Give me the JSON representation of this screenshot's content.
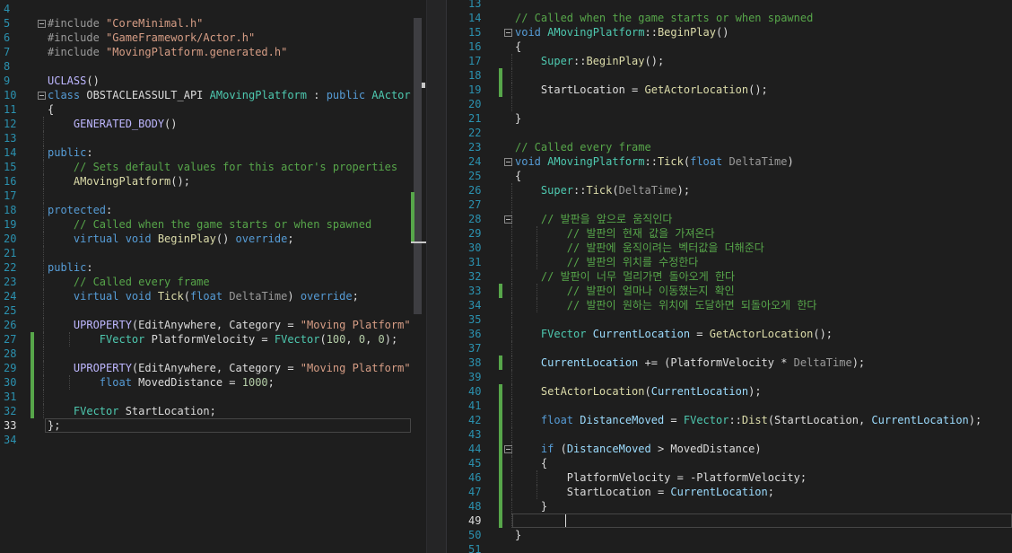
{
  "left_editor": {
    "file": "MovingPlatform.h",
    "lines": [
      {
        "n": "4",
        "tokens": []
      },
      {
        "n": "5",
        "tokens": [
          {
            "t": "#include ",
            "c": "pp"
          },
          {
            "t": "\"CoreMinimal.h\"",
            "c": "str"
          }
        ]
      },
      {
        "n": "6",
        "tokens": [
          {
            "t": "#include ",
            "c": "pp"
          },
          {
            "t": "\"GameFramework/Actor.h\"",
            "c": "str"
          }
        ]
      },
      {
        "n": "7",
        "tokens": [
          {
            "t": "#include ",
            "c": "pp"
          },
          {
            "t": "\"MovingPlatform.generated.h\"",
            "c": "str"
          }
        ]
      },
      {
        "n": "8",
        "tokens": []
      },
      {
        "n": "9",
        "tokens": [
          {
            "t": "UCLASS",
            "c": "mac"
          },
          {
            "t": "()",
            "c": "tx"
          }
        ]
      },
      {
        "n": "10",
        "tokens": [
          {
            "t": "class ",
            "c": "kw"
          },
          {
            "t": "OBSTACLEASSULT_API ",
            "c": "tx"
          },
          {
            "t": "AMovingPlatform",
            "c": "ty"
          },
          {
            "t": " : ",
            "c": "tx"
          },
          {
            "t": "public ",
            "c": "kw"
          },
          {
            "t": "AActor",
            "c": "ty"
          }
        ]
      },
      {
        "n": "11",
        "tokens": [
          {
            "t": "{",
            "c": "tx"
          }
        ]
      },
      {
        "n": "12",
        "tokens": [
          {
            "t": "    GENERATED_BODY",
            "c": "mac"
          },
          {
            "t": "()",
            "c": "tx"
          }
        ]
      },
      {
        "n": "13",
        "tokens": []
      },
      {
        "n": "14",
        "tokens": [
          {
            "t": "public",
            "c": "kw"
          },
          {
            "t": ":",
            "c": "tx"
          }
        ]
      },
      {
        "n": "15",
        "tokens": [
          {
            "t": "    // Sets default values for this actor's properties",
            "c": "cm"
          }
        ]
      },
      {
        "n": "16",
        "tokens": [
          {
            "t": "    ",
            "c": "tx"
          },
          {
            "t": "AMovingPlatform",
            "c": "fn"
          },
          {
            "t": "();",
            "c": "tx"
          }
        ]
      },
      {
        "n": "17",
        "tokens": []
      },
      {
        "n": "18",
        "tokens": [
          {
            "t": "protected",
            "c": "kw"
          },
          {
            "t": ":",
            "c": "tx"
          }
        ]
      },
      {
        "n": "19",
        "tokens": [
          {
            "t": "    // Called when the game starts or when spawned",
            "c": "cm"
          }
        ]
      },
      {
        "n": "20",
        "tokens": [
          {
            "t": "    virtual void ",
            "c": "kw"
          },
          {
            "t": "BeginPlay",
            "c": "fn"
          },
          {
            "t": "() ",
            "c": "tx"
          },
          {
            "t": "override",
            "c": "kw"
          },
          {
            "t": ";",
            "c": "tx"
          }
        ]
      },
      {
        "n": "21",
        "tokens": []
      },
      {
        "n": "22",
        "tokens": [
          {
            "t": "public",
            "c": "kw"
          },
          {
            "t": ":",
            "c": "tx"
          }
        ]
      },
      {
        "n": "23",
        "tokens": [
          {
            "t": "    // Called every frame",
            "c": "cm"
          }
        ]
      },
      {
        "n": "24",
        "tokens": [
          {
            "t": "    virtual void ",
            "c": "kw"
          },
          {
            "t": "Tick",
            "c": "fn"
          },
          {
            "t": "(",
            "c": "tx"
          },
          {
            "t": "float ",
            "c": "kw"
          },
          {
            "t": "DeltaTime",
            "c": "prm"
          },
          {
            "t": ") ",
            "c": "tx"
          },
          {
            "t": "override",
            "c": "kw"
          },
          {
            "t": ";",
            "c": "tx"
          }
        ]
      },
      {
        "n": "25",
        "tokens": []
      },
      {
        "n": "26",
        "tokens": [
          {
            "t": "    UPROPERTY",
            "c": "mac"
          },
          {
            "t": "(EditAnywhere, Category = ",
            "c": "tx"
          },
          {
            "t": "\"Moving Platform\"",
            "c": "str"
          },
          {
            "t": ")",
            "c": "tx"
          }
        ]
      },
      {
        "n": "27",
        "tokens": [
          {
            "t": "        ",
            "c": "tx"
          },
          {
            "t": "FVector ",
            "c": "ty"
          },
          {
            "t": "PlatformVelocity = ",
            "c": "tx"
          },
          {
            "t": "FVector",
            "c": "ty"
          },
          {
            "t": "(",
            "c": "tx"
          },
          {
            "t": "100",
            "c": "num"
          },
          {
            "t": ", ",
            "c": "tx"
          },
          {
            "t": "0",
            "c": "num"
          },
          {
            "t": ", ",
            "c": "tx"
          },
          {
            "t": "0",
            "c": "num"
          },
          {
            "t": ");",
            "c": "tx"
          }
        ]
      },
      {
        "n": "28",
        "tokens": []
      },
      {
        "n": "29",
        "tokens": [
          {
            "t": "    UPROPERTY",
            "c": "mac"
          },
          {
            "t": "(EditAnywhere, Category = ",
            "c": "tx"
          },
          {
            "t": "\"Moving Platform\"",
            "c": "str"
          },
          {
            "t": ")",
            "c": "tx"
          }
        ]
      },
      {
        "n": "30",
        "tokens": [
          {
            "t": "        ",
            "c": "tx"
          },
          {
            "t": "float ",
            "c": "kw"
          },
          {
            "t": "MovedDistance = ",
            "c": "tx"
          },
          {
            "t": "1000",
            "c": "num"
          },
          {
            "t": ";",
            "c": "tx"
          }
        ]
      },
      {
        "n": "31",
        "tokens": []
      },
      {
        "n": "32",
        "tokens": [
          {
            "t": "    ",
            "c": "tx"
          },
          {
            "t": "FVector ",
            "c": "ty"
          },
          {
            "t": "StartLocation;",
            "c": "tx"
          }
        ]
      },
      {
        "n": "33",
        "tokens": [
          {
            "t": "};",
            "c": "tx"
          }
        ]
      },
      {
        "n": "34",
        "tokens": []
      }
    ]
  },
  "right_editor": {
    "file": "MovingPlatform.cpp",
    "lines": [
      {
        "n": "13",
        "tokens": []
      },
      {
        "n": "14",
        "tokens": [
          {
            "t": "// Called when the game starts or when spawned",
            "c": "cm"
          }
        ]
      },
      {
        "n": "15",
        "tokens": [
          {
            "t": "void ",
            "c": "kw"
          },
          {
            "t": "AMovingPlatform",
            "c": "ty"
          },
          {
            "t": "::",
            "c": "tx"
          },
          {
            "t": "BeginPlay",
            "c": "fn"
          },
          {
            "t": "()",
            "c": "tx"
          }
        ]
      },
      {
        "n": "16",
        "tokens": [
          {
            "t": "{",
            "c": "tx"
          }
        ]
      },
      {
        "n": "17",
        "tokens": [
          {
            "t": "    ",
            "c": "tx"
          },
          {
            "t": "Super",
            "c": "ty"
          },
          {
            "t": "::",
            "c": "tx"
          },
          {
            "t": "BeginPlay",
            "c": "fn"
          },
          {
            "t": "();",
            "c": "tx"
          }
        ]
      },
      {
        "n": "18",
        "tokens": []
      },
      {
        "n": "19",
        "tokens": [
          {
            "t": "    StartLocation = ",
            "c": "tx"
          },
          {
            "t": "GetActorLocation",
            "c": "fn"
          },
          {
            "t": "();",
            "c": "tx"
          }
        ]
      },
      {
        "n": "20",
        "tokens": []
      },
      {
        "n": "21",
        "tokens": [
          {
            "t": "}",
            "c": "tx"
          }
        ]
      },
      {
        "n": "22",
        "tokens": []
      },
      {
        "n": "23",
        "tokens": [
          {
            "t": "// Called every frame",
            "c": "cm"
          }
        ]
      },
      {
        "n": "24",
        "tokens": [
          {
            "t": "void ",
            "c": "kw"
          },
          {
            "t": "AMovingPlatform",
            "c": "ty"
          },
          {
            "t": "::",
            "c": "tx"
          },
          {
            "t": "Tick",
            "c": "fn"
          },
          {
            "t": "(",
            "c": "tx"
          },
          {
            "t": "float ",
            "c": "kw"
          },
          {
            "t": "DeltaTime",
            "c": "prm"
          },
          {
            "t": ")",
            "c": "tx"
          }
        ]
      },
      {
        "n": "25",
        "tokens": [
          {
            "t": "{",
            "c": "tx"
          }
        ]
      },
      {
        "n": "26",
        "tokens": [
          {
            "t": "    ",
            "c": "tx"
          },
          {
            "t": "Super",
            "c": "ty"
          },
          {
            "t": "::",
            "c": "tx"
          },
          {
            "t": "Tick",
            "c": "fn"
          },
          {
            "t": "(",
            "c": "tx"
          },
          {
            "t": "DeltaTime",
            "c": "prm"
          },
          {
            "t": ");",
            "c": "tx"
          }
        ]
      },
      {
        "n": "27",
        "tokens": []
      },
      {
        "n": "28",
        "tokens": [
          {
            "t": "    // 발판을 앞으로 움직인다",
            "c": "cm"
          }
        ]
      },
      {
        "n": "29",
        "tokens": [
          {
            "t": "        // 발판의 현재 값을 가져온다",
            "c": "cm"
          }
        ]
      },
      {
        "n": "30",
        "tokens": [
          {
            "t": "        // 발판에 움직이려는 벡터값을 더해준다",
            "c": "cm"
          }
        ]
      },
      {
        "n": "31",
        "tokens": [
          {
            "t": "        // 발판의 위치를 수정한다",
            "c": "cm"
          }
        ]
      },
      {
        "n": "32",
        "tokens": [
          {
            "t": "    // 발판이 너무 멀리가면 돌아오게 한다",
            "c": "cm"
          }
        ]
      },
      {
        "n": "33",
        "tokens": [
          {
            "t": "        // 발판이 얼마나 이동했는지 확인",
            "c": "cm"
          }
        ]
      },
      {
        "n": "34",
        "tokens": [
          {
            "t": "        // 발판이 원하는 위치에 도달하면 되돌아오게 한다",
            "c": "cm"
          }
        ]
      },
      {
        "n": "35",
        "tokens": []
      },
      {
        "n": "36",
        "tokens": [
          {
            "t": "    ",
            "c": "tx"
          },
          {
            "t": "FVector ",
            "c": "ty"
          },
          {
            "t": "CurrentLocation",
            "c": "var"
          },
          {
            "t": " = ",
            "c": "tx"
          },
          {
            "t": "GetActorLocation",
            "c": "fn"
          },
          {
            "t": "();",
            "c": "tx"
          }
        ]
      },
      {
        "n": "37",
        "tokens": []
      },
      {
        "n": "38",
        "tokens": [
          {
            "t": "    ",
            "c": "tx"
          },
          {
            "t": "CurrentLocation",
            "c": "var"
          },
          {
            "t": " += (PlatformVelocity * ",
            "c": "tx"
          },
          {
            "t": "DeltaTime",
            "c": "prm"
          },
          {
            "t": ");",
            "c": "tx"
          }
        ]
      },
      {
        "n": "39",
        "tokens": []
      },
      {
        "n": "40",
        "tokens": [
          {
            "t": "    ",
            "c": "tx"
          },
          {
            "t": "SetActorLocation",
            "c": "fn"
          },
          {
            "t": "(",
            "c": "tx"
          },
          {
            "t": "CurrentLocation",
            "c": "var"
          },
          {
            "t": ");",
            "c": "tx"
          }
        ]
      },
      {
        "n": "41",
        "tokens": []
      },
      {
        "n": "42",
        "tokens": [
          {
            "t": "    ",
            "c": "tx"
          },
          {
            "t": "float ",
            "c": "kw"
          },
          {
            "t": "DistanceMoved",
            "c": "var"
          },
          {
            "t": " = ",
            "c": "tx"
          },
          {
            "t": "FVector",
            "c": "ty"
          },
          {
            "t": "::",
            "c": "tx"
          },
          {
            "t": "Dist",
            "c": "fn"
          },
          {
            "t": "(StartLocation, ",
            "c": "tx"
          },
          {
            "t": "CurrentLocation",
            "c": "var"
          },
          {
            "t": ");",
            "c": "tx"
          }
        ]
      },
      {
        "n": "43",
        "tokens": []
      },
      {
        "n": "44",
        "tokens": [
          {
            "t": "    ",
            "c": "tx"
          },
          {
            "t": "if ",
            "c": "kw"
          },
          {
            "t": "(",
            "c": "tx"
          },
          {
            "t": "DistanceMoved",
            "c": "var"
          },
          {
            "t": " > MovedDistance)",
            "c": "tx"
          }
        ]
      },
      {
        "n": "45",
        "tokens": [
          {
            "t": "    {",
            "c": "tx"
          }
        ]
      },
      {
        "n": "46",
        "tokens": [
          {
            "t": "        PlatformVelocity = -PlatformVelocity;",
            "c": "tx"
          }
        ]
      },
      {
        "n": "47",
        "tokens": [
          {
            "t": "        StartLocation = ",
            "c": "tx"
          },
          {
            "t": "CurrentLocation",
            "c": "var"
          },
          {
            "t": ";",
            "c": "tx"
          }
        ]
      },
      {
        "n": "48",
        "tokens": [
          {
            "t": "    }",
            "c": "tx"
          }
        ]
      },
      {
        "n": "49",
        "tokens": []
      },
      {
        "n": "50",
        "tokens": [
          {
            "t": "}",
            "c": "tx"
          }
        ]
      },
      {
        "n": "51",
        "tokens": []
      }
    ]
  }
}
